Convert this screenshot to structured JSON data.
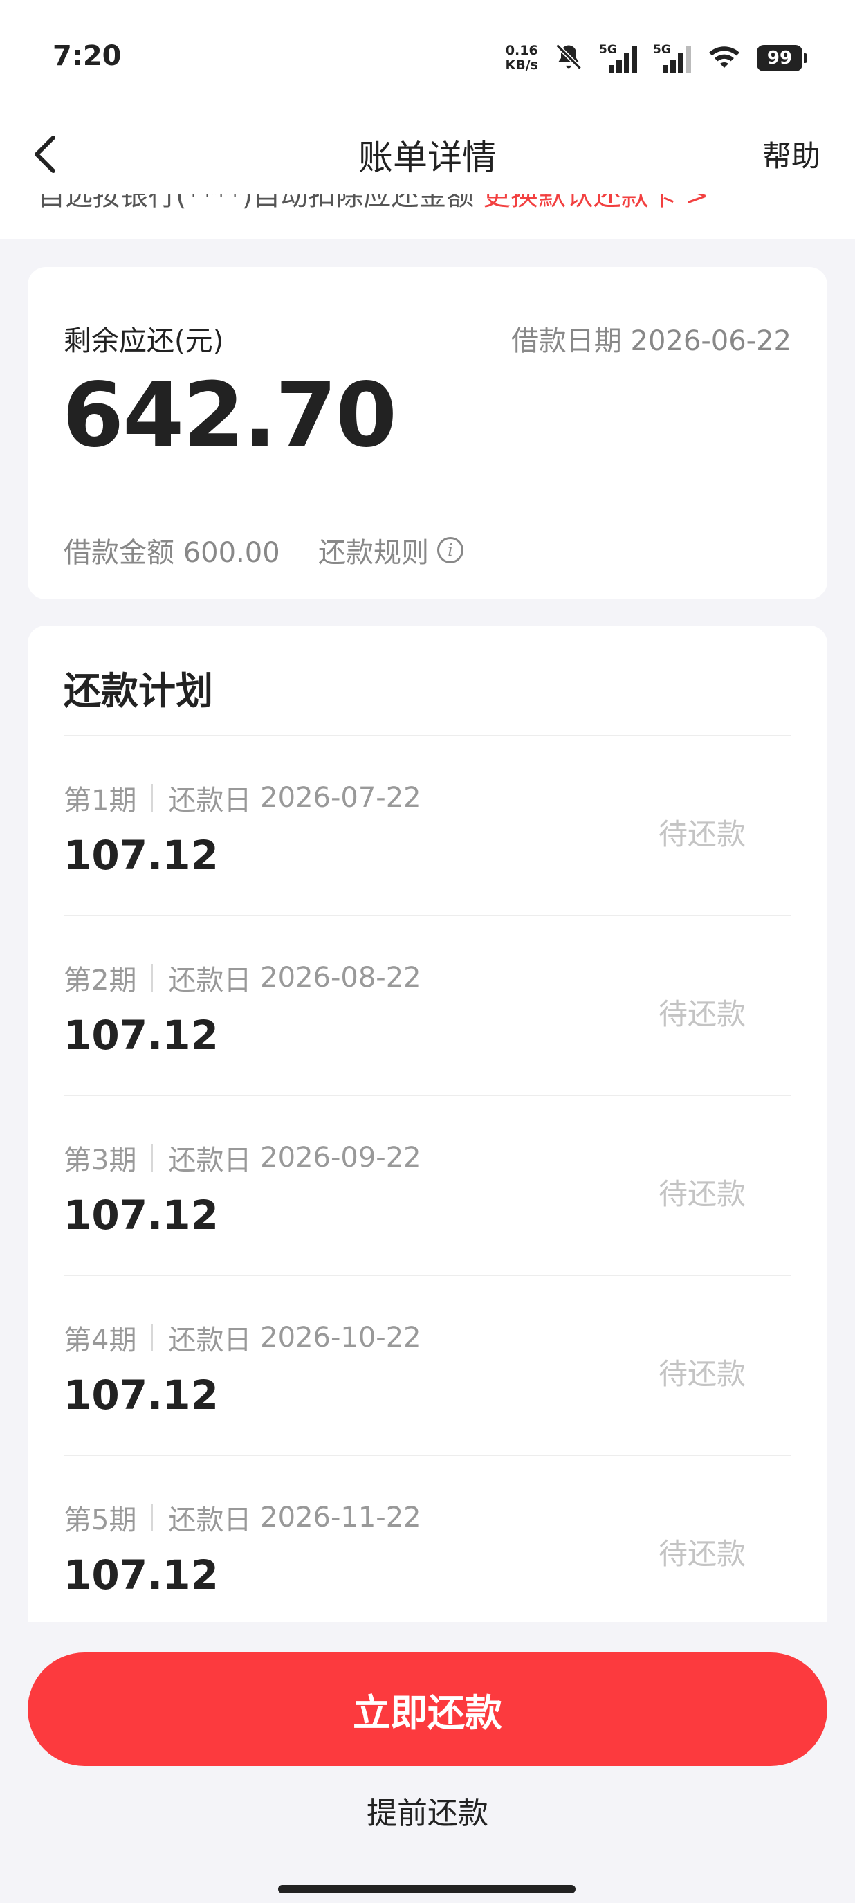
{
  "status_bar": {
    "time": "7:20",
    "net_speed_value": "0.16",
    "net_speed_unit": "KB/s",
    "signal1_label": "5G",
    "signal2_label": "5G",
    "battery": "99",
    "icons": [
      "bell-muted-icon",
      "signal-icon",
      "signal-icon",
      "wifi-icon",
      "battery-icon"
    ]
  },
  "nav": {
    "title": "账单详情",
    "help_label": "帮助",
    "back_icon": "chevron-left-icon"
  },
  "notice": {
    "gray_text": "自选按银行(****)自动扣除应还金额",
    "red_text": "更换默认还款卡 >"
  },
  "summary": {
    "remaining_label": "剩余应还(元)",
    "remaining_amount": "642.70",
    "loan_date_label": "借款日期",
    "loan_date": "2026-06-22",
    "loan_amount_label": "借款金额",
    "loan_amount": "600.00",
    "rules_label": "还款规则"
  },
  "plan": {
    "title": "还款计划",
    "due_label": "还款日",
    "items": [
      {
        "period": "第1期",
        "date": "2026-07-22",
        "amount": "107.12",
        "status": "待还款"
      },
      {
        "period": "第2期",
        "date": "2026-08-22",
        "amount": "107.12",
        "status": "待还款"
      },
      {
        "period": "第3期",
        "date": "2026-09-22",
        "amount": "107.12",
        "status": "待还款"
      },
      {
        "period": "第4期",
        "date": "2026-10-22",
        "amount": "107.12",
        "status": "待还款"
      },
      {
        "period": "第5期",
        "date": "2026-11-22",
        "amount": "107.12",
        "status": "待还款"
      }
    ]
  },
  "actions": {
    "pay_now": "立即还款",
    "prepay": "提前还款"
  },
  "colors": {
    "accent": "#fc3a3e",
    "notice_red": "#f24040",
    "background": "#f4f4f8"
  }
}
